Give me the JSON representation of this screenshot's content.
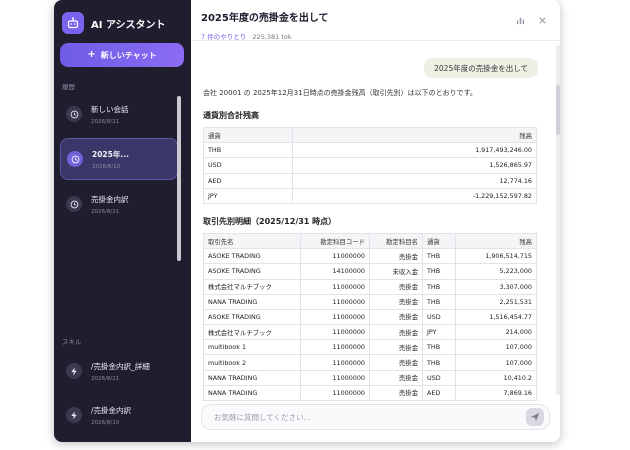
{
  "app": {
    "title": "AI アシスタント",
    "new_chat_label": "新しいチャット"
  },
  "sidebar": {
    "history_label": "履歴",
    "history": [
      {
        "title": "新しい会話",
        "date": "2026/8/21",
        "active": false
      },
      {
        "title": "2025年...",
        "date": "2026/8/10",
        "active": true
      },
      {
        "title": "売掛金内訳",
        "date": "2026/8/21",
        "active": false
      }
    ],
    "skills_label": "スキル",
    "skills": [
      {
        "title": "/売掛金内訳_詳細",
        "date": "2026/8/21"
      },
      {
        "title": "/売掛金内訳",
        "date": "2026/8/10"
      }
    ]
  },
  "chat": {
    "title": "2025年度の売掛金を出して",
    "exchange_count": "7 件のやりとり",
    "tokens": "225,381 tok",
    "user_message": "2025年度の売掛金を出して",
    "intro": "会社 20001 の 2025年12月31日時点の売掛金残高（取引先別）は以下のとおりです。",
    "currency_heading": "通貨別合計残高",
    "currency_table": {
      "headers": [
        "通貨",
        "残高"
      ],
      "rows": [
        [
          "THB",
          "1,917,493,246.00"
        ],
        [
          "USD",
          "1,526,865.97"
        ],
        [
          "AED",
          "12,774.16"
        ],
        [
          "JPY",
          "-1,229,152,597.82"
        ]
      ]
    },
    "detail_heading": "取引先別明細（2025/12/31 時点）",
    "detail_table": {
      "headers": [
        "取引先名",
        "勘定科目コード",
        "勘定科目名",
        "通貨",
        "残高"
      ],
      "rows": [
        [
          "ASOKE TRADING",
          "11000000",
          "売掛金",
          "THB",
          "1,906,514,715"
        ],
        [
          "ASOKE TRADING",
          "14100000",
          "未収入金",
          "THB",
          "5,223,000"
        ],
        [
          "株式会社マルチブック",
          "11000000",
          "売掛金",
          "THB",
          "3,307,000"
        ],
        [
          "NANA TRADING",
          "11000000",
          "売掛金",
          "THB",
          "2,251,531"
        ],
        [
          "ASOKE TRADING",
          "11000000",
          "売掛金",
          "USD",
          "1,516,454.77"
        ],
        [
          "株式会社マルチブック",
          "11000000",
          "売掛金",
          "JPY",
          "214,000"
        ],
        [
          "multibook 1",
          "11000000",
          "売掛金",
          "THB",
          "107,000"
        ],
        [
          "multibook 2",
          "11000000",
          "売掛金",
          "THB",
          "107,000"
        ],
        [
          "NANA TRADING",
          "11000000",
          "売掛金",
          "USD",
          "10,410.2"
        ],
        [
          "NANA TRADING",
          "11000000",
          "売掛金",
          "AED",
          "7,869.16"
        ]
      ]
    },
    "input_placeholder": "お気軽に質問してください..."
  },
  "colors": {
    "accent": "#6f5ce6",
    "sidebar_bg": "#1f1d2e"
  }
}
